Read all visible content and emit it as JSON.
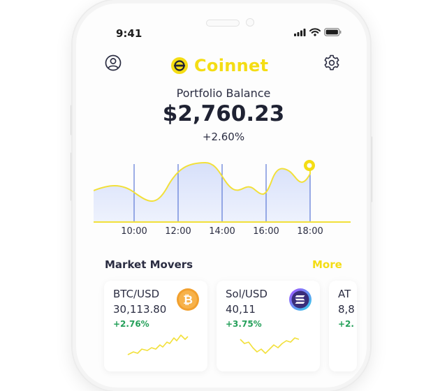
{
  "status_bar": {
    "time": "9:41"
  },
  "header": {
    "app_name": "Coinnet",
    "brand_color": "#f4dd14",
    "profile_icon": "user-circle-icon",
    "settings_icon": "gear-icon"
  },
  "portfolio": {
    "label": "Portfolio Balance",
    "balance": "$2,760.23",
    "change": "+2.60%"
  },
  "chart": {
    "time_labels": [
      "10:00",
      "12:00",
      "14:00",
      "16:00",
      "18:00"
    ],
    "line_color": "#f2e03a",
    "fill_color": "#dfe6fa"
  },
  "market_movers": {
    "title": "Market Movers",
    "more_label": "More",
    "cards": [
      {
        "pair": "BTC/USD",
        "price": "30,113.80",
        "change": "+2.76%",
        "icon": "bitcoin-icon"
      },
      {
        "pair": "Sol/USD",
        "price": "40,11",
        "change": "+3.75%",
        "icon": "solana-icon"
      },
      {
        "pair": "AT",
        "price": "8,8",
        "change": "+2."
      }
    ]
  }
}
